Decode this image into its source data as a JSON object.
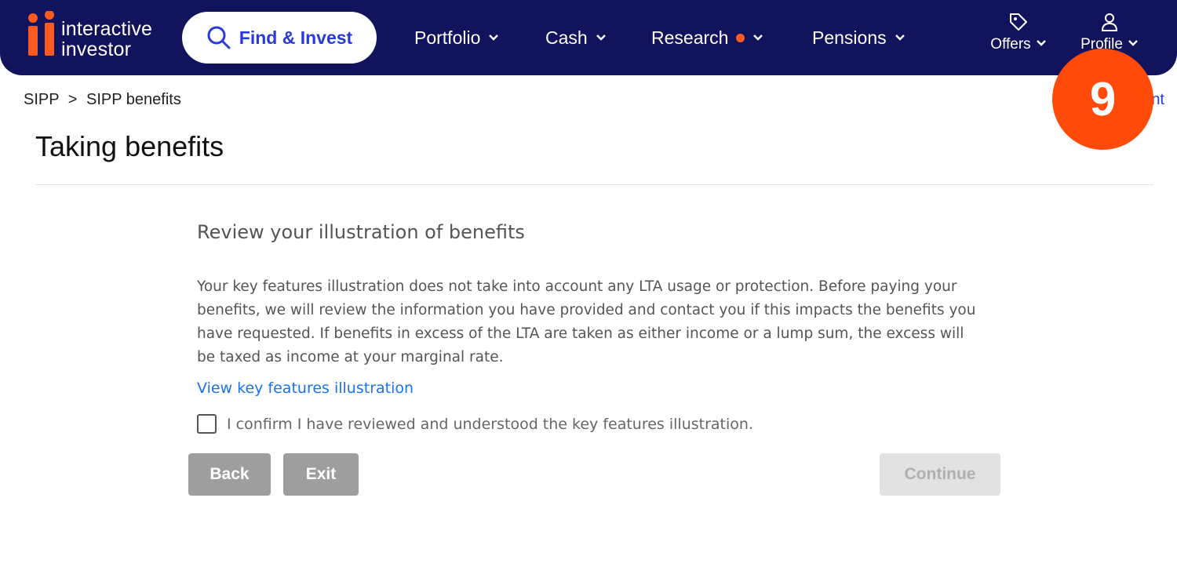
{
  "header": {
    "logo_text_line1": "interactive",
    "logo_text_line2": "investor",
    "find_invest": "Find & Invest",
    "nav": [
      {
        "label": "Portfolio"
      },
      {
        "label": "Cash"
      },
      {
        "label": "Research"
      },
      {
        "label": "Pensions"
      }
    ],
    "offers": "Offers",
    "profile": "Profile"
  },
  "breadcrumb": {
    "items": [
      "SIPP",
      "SIPP benefits"
    ],
    "separator": ">"
  },
  "right_link_partial": "nt",
  "step_badge": "9",
  "page_title": "Taking benefits",
  "main": {
    "section_title": "Review your illustration of benefits",
    "body": "Your key features illustration does not take into account any LTA usage or protection. Before paying your benefits, we will review the information you have provided and contact you if this impacts the benefits you have requested. If benefits in excess of the LTA are taken as either income or a lump sum, the excess will be taxed as income at your marginal rate.",
    "link": "View key features illustration",
    "confirm_label": "I confirm I have reviewed and understood the key features illustration.",
    "confirm_checked": false
  },
  "buttons": {
    "back": "Back",
    "exit": "Exit",
    "continue": "Continue"
  },
  "colors": {
    "header_bg": "#11145c",
    "brand_orange": "#ff5a1f",
    "badge": "#ff4a0a",
    "link": "#1a73e8"
  }
}
